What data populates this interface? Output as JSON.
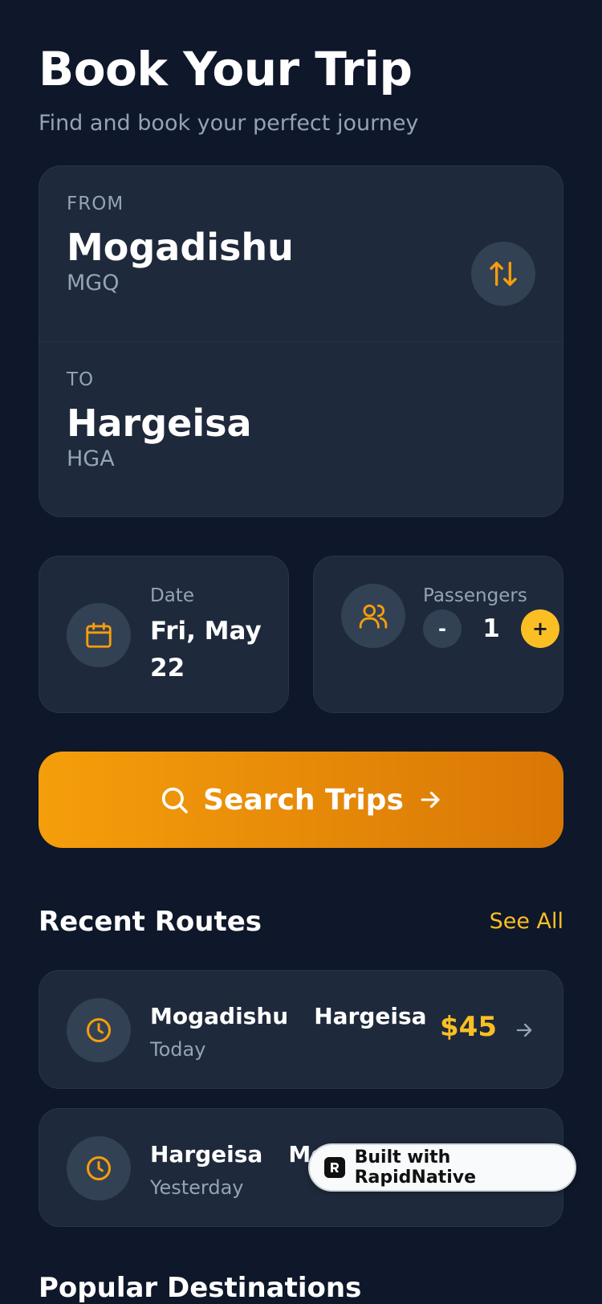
{
  "header": {
    "title": "Book Your Trip",
    "subtitle": "Find and book your perfect journey"
  },
  "route": {
    "from_label": "FROM",
    "from_city": "Mogadishu",
    "from_code": "MGQ",
    "to_label": "TO",
    "to_city": "Hargeisa",
    "to_code": "HGA",
    "swap_icon": "swap-vertical-icon"
  },
  "date": {
    "label": "Date",
    "value": "Fri, May 22",
    "icon": "calendar-icon"
  },
  "passengers": {
    "label": "Passengers",
    "minus_label": "-",
    "plus_label": "+",
    "count": "1",
    "icon": "users-icon"
  },
  "search": {
    "label": "Search Trips",
    "icon": "search-icon",
    "arrow_icon": "arrow-right-icon"
  },
  "recent": {
    "title": "Recent Routes",
    "see_all": "See All",
    "items": [
      {
        "from": "Mogadishu",
        "to": "Hargeisa",
        "when": "Today",
        "price": "$45"
      },
      {
        "from": "Hargeisa",
        "to": "Mogadishu",
        "when": "Yesterday",
        "price": ""
      }
    ]
  },
  "popular": {
    "title": "Popular Destinations"
  },
  "badge": {
    "label": "Built with RapidNative"
  },
  "colors": {
    "background": "#0f172a",
    "card": "#1e293b",
    "accent": "#fbbf24",
    "accent_gradient_start": "#f59e0b",
    "accent_gradient_end": "#d97706",
    "muted_text": "#94a3b8"
  }
}
